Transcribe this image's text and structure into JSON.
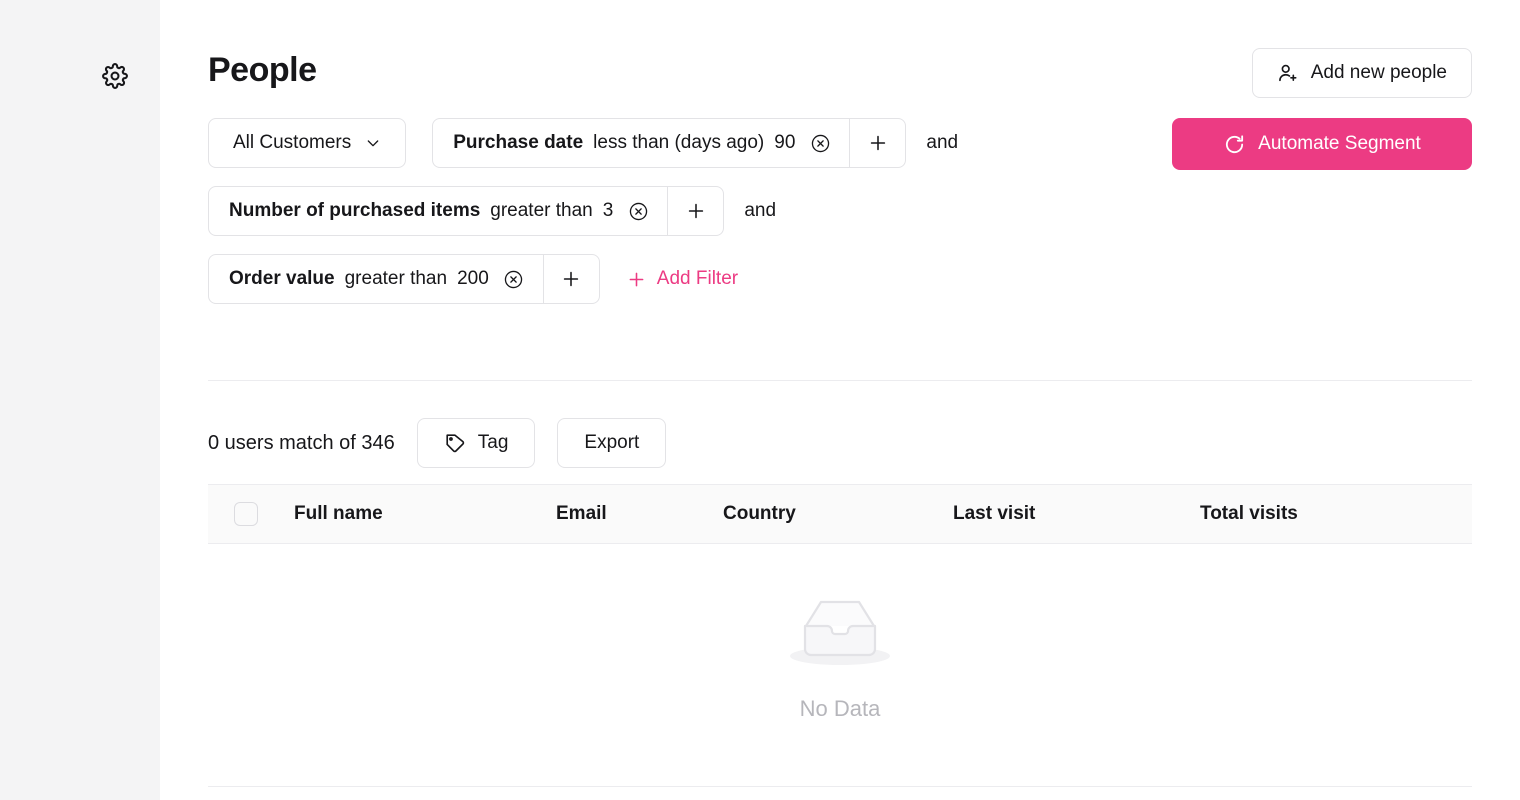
{
  "sidebar": {
    "gear_icon": "gear-icon"
  },
  "header": {
    "title": "People",
    "add_people_label": "Add new people",
    "add_people_icon": "person-add-icon",
    "automate_label": "Automate Segment",
    "automate_icon": "refresh-icon",
    "accent_color": "#ec3b83"
  },
  "segment_select": {
    "value": "All Customers",
    "chevron_icon": "chevron-down-icon"
  },
  "filters": {
    "add_filter_label": "Add Filter",
    "add_filter_icon": "plus-icon",
    "conjunction": "and",
    "plus_icon": "plus-icon",
    "remove_icon": "close-circle-icon",
    "rows": [
      {
        "field": "Purchase date",
        "operator": "less than (days ago)",
        "value": "90",
        "conjunction": "and"
      },
      {
        "field": "Number of purchased items",
        "operator": "greater than",
        "value": "3",
        "conjunction": "and"
      },
      {
        "field": "Order value",
        "operator": "greater than",
        "value": "200",
        "conjunction": ""
      }
    ]
  },
  "results": {
    "match_text": "0 users match of 346",
    "tag_label": "Tag",
    "tag_icon": "tag-icon",
    "export_label": "Export"
  },
  "table": {
    "columns": [
      "Full name",
      "Email",
      "Country",
      "Last visit",
      "Total visits"
    ],
    "rows": [],
    "empty_label": "No Data",
    "empty_icon": "inbox-icon"
  }
}
